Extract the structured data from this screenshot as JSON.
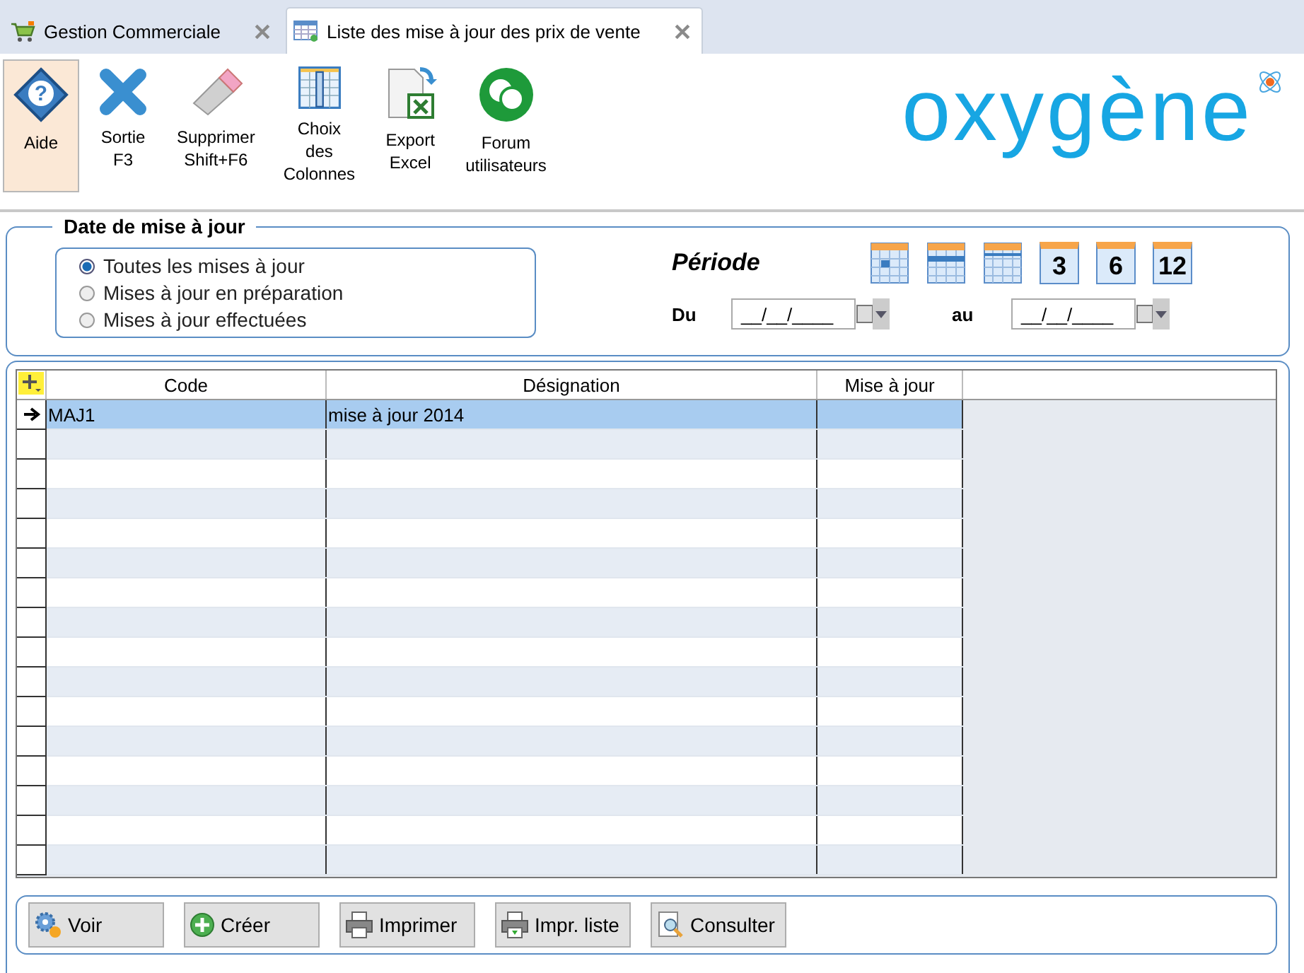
{
  "tabs": [
    {
      "label": "Gestion Commerciale",
      "selected": false,
      "kind": "cart"
    },
    {
      "label": "Liste des mise à jour des prix de vente",
      "selected": true,
      "kind": "list"
    }
  ],
  "toolbar": [
    {
      "label": "Aide",
      "selected": true,
      "kind": "help",
      "glyph": "?"
    },
    {
      "label": "Sortie\nF3",
      "selected": false,
      "kind": "exit"
    },
    {
      "label": "Supprimer\nShift+F6",
      "selected": false,
      "kind": "eraser"
    },
    {
      "label": "Choix\ndes\nColonnes",
      "selected": false,
      "kind": "columns"
    },
    {
      "label": "Export\nExcel",
      "selected": false,
      "kind": "excel"
    },
    {
      "label": "Forum\nutilisateurs",
      "selected": false,
      "kind": "forum"
    }
  ],
  "logo": {
    "text": "oxygène"
  },
  "filter": {
    "title": "Date de mise à jour",
    "options": [
      {
        "label": "Toutes les mises à jour",
        "selected": true
      },
      {
        "label": "Mises à jour en préparation",
        "selected": false
      },
      {
        "label": "Mises à jour effectuées",
        "selected": false
      }
    ]
  },
  "period": {
    "title": "Période",
    "presets": [
      {
        "kind": "day"
      },
      {
        "kind": "week"
      },
      {
        "kind": "month"
      },
      {
        "kind": "number",
        "label": "3"
      },
      {
        "kind": "number",
        "label": "6"
      },
      {
        "kind": "number",
        "label": "12"
      }
    ],
    "from": {
      "label": "Du",
      "value": "__/__/____"
    },
    "to": {
      "label": "au",
      "value": "__/__/____"
    }
  },
  "table": {
    "columns": [
      "Code",
      "Désignation",
      "Mise à jour"
    ],
    "rows": [
      {
        "cells": [
          "MAJ1",
          "mise à jour 2014",
          ""
        ],
        "selected": true
      }
    ]
  },
  "buttons": [
    {
      "label": "Voir",
      "kind": "gears"
    },
    {
      "label": "Créer",
      "kind": "add"
    },
    {
      "label": "Imprimer",
      "kind": "print"
    },
    {
      "label": "Impr. liste",
      "kind": "printlist"
    },
    {
      "label": "Consulter",
      "kind": "view"
    }
  ]
}
